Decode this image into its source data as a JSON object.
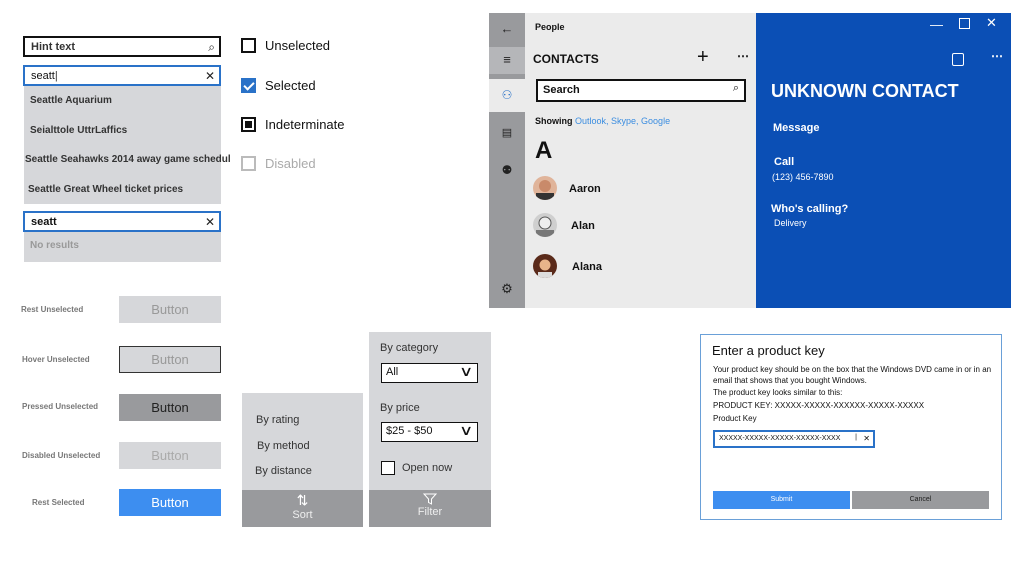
{
  "search": {
    "hint": "Hint text",
    "query1": "seatt",
    "suggestions": [
      "Seattle Aquarium",
      "Seialttole UttrLaffics",
      "Seattle Seahawks 2014 away game schedul",
      "Seattle Great Wheel ticket prices"
    ],
    "query2": "seatt",
    "no_results": "No results"
  },
  "checkboxes": {
    "unselected": "Unselected",
    "selected": "Selected",
    "indeterminate": "Indeterminate",
    "disabled": "Disabled"
  },
  "buttons": {
    "states": [
      "Rest Unselected",
      "Hover Unselected",
      "Pressed Unselected",
      "Disabled Unselected",
      "Rest Selected"
    ],
    "label": "Button"
  },
  "sort": {
    "items": [
      "By rating",
      "By method",
      "By distance"
    ],
    "tab_label": "Sort"
  },
  "filter": {
    "category_label": "By category",
    "category_value": "All",
    "price_label": "By price",
    "price_value": "$25 - $50",
    "open_now": "Open now",
    "tab_label": "Filter"
  },
  "people": {
    "app_title": "People",
    "contacts_title": "CONTACTS",
    "search_placeholder": "Search",
    "showing_label": "Showing",
    "showing_sources": "Outlook, Skype, Google",
    "letter": "A",
    "contacts": [
      "Aaron",
      "Alan",
      "Alana"
    ],
    "detail": {
      "name": "UNKNOWN CONTACT",
      "message": "Message",
      "call": "Call",
      "phone": "(123) 456-7890",
      "whos_calling": "Who's calling?",
      "reason": "Delivery"
    }
  },
  "dialog": {
    "title": "Enter a product key",
    "body1": "Your  product key should be on the box that the Windows DVD came in or in an email that shows that you bought Windows.",
    "body2": "The product key looks similar to this:",
    "body3": "PRODUCT KEY: XXXXX-XXXXX-XXXXXX-XXXXX-XXXXX",
    "field_label": "Product Key",
    "field_value": "XXXXX-XXXXX-XXXXX-XXXXX-XXXX",
    "submit": "Submit",
    "cancel": "Cancel"
  },
  "colors": {
    "accent": "#2a72c8",
    "detail_bg": "#0b4fb5",
    "link": "#3b8de0",
    "selected_button": "#3d8ef0"
  }
}
